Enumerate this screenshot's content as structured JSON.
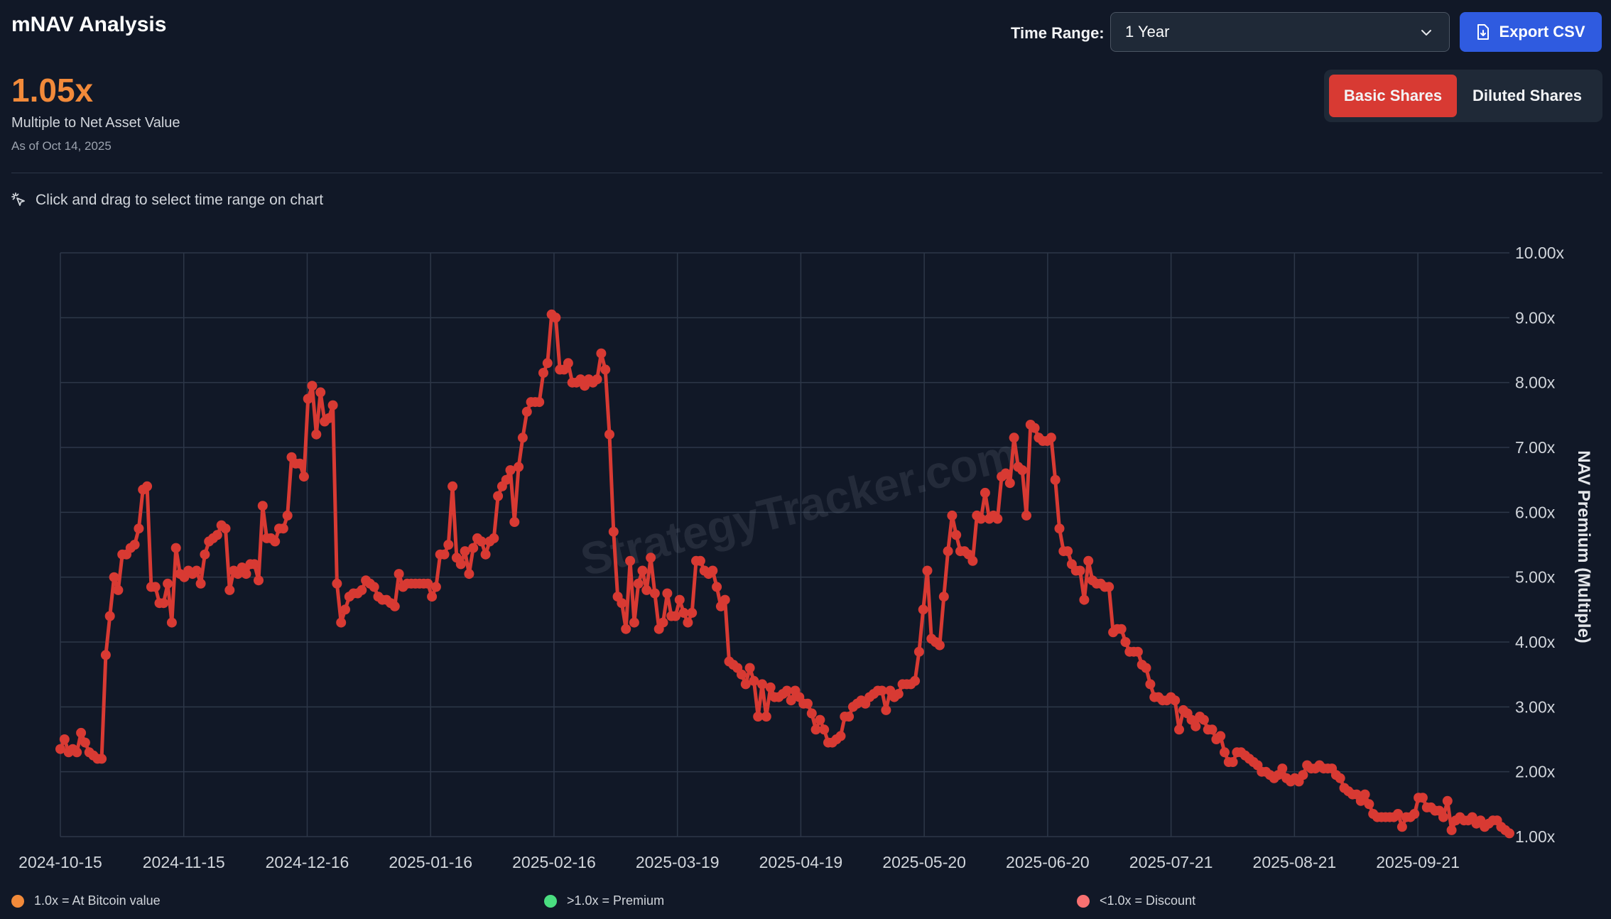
{
  "header": {
    "title": "mNAV Analysis",
    "time_range_label": "Time Range:",
    "time_range_value": "1 Year",
    "export_label": "Export CSV"
  },
  "summary": {
    "value": "1.05x",
    "label": "Multiple to Net Asset Value",
    "as_of": "As of Oct 14, 2025"
  },
  "toggle": {
    "basic": "Basic Shares",
    "diluted": "Diluted Shares",
    "active": "basic"
  },
  "hint": "Click and drag to select time range on chart",
  "watermark": "StrategyTracker.com",
  "legend": [
    {
      "label": "1.0x = At Bitcoin value",
      "color": "#f28a3a"
    },
    {
      "label": ">1.0x = Premium",
      "color": "#4ade80"
    },
    {
      "label": "<1.0x = Discount",
      "color": "#f87171"
    }
  ],
  "colors": {
    "series": "#d83a33",
    "accent": "#f28a3a",
    "grid": "#2d3748"
  },
  "chart_data": {
    "type": "line",
    "ylabel": "NAV Premium (Multiple)",
    "ylim": [
      1,
      10
    ],
    "yticks": [
      "10.00x",
      "9.00x",
      "8.00x",
      "7.00x",
      "6.00x",
      "5.00x",
      "4.00x",
      "3.00x",
      "2.00x",
      "1.00x"
    ],
    "xticks": [
      "2024-10-15",
      "2024-11-15",
      "2024-12-16",
      "2025-01-16",
      "2025-02-16",
      "2025-03-19",
      "2025-04-19",
      "2025-05-20",
      "2025-06-20",
      "2025-07-21",
      "2025-08-21",
      "2025-09-21"
    ],
    "x_start": "2024-10-15",
    "x_end": "2025-10-14",
    "grid": true,
    "legend_position": "bottom",
    "series": [
      {
        "values": [
          2.35,
          2.5,
          2.3,
          2.35,
          2.3,
          2.6,
          2.45,
          2.3,
          2.25,
          2.2,
          2.2,
          3.8,
          4.4,
          5,
          4.8,
          5.35,
          5.35,
          5.45,
          5.5,
          5.75,
          6.35,
          6.4,
          4.85,
          4.85,
          4.6,
          4.6,
          4.9,
          4.3,
          5.45,
          5.05,
          5,
          5.1,
          5.05,
          5.1,
          4.9,
          5.35,
          5.55,
          5.6,
          5.65,
          5.8,
          5.75,
          4.8,
          5.1,
          5.05,
          5.15,
          5.05,
          5.2,
          5.2,
          4.95,
          6.1,
          5.6,
          5.6,
          5.55,
          5.75,
          5.75,
          5.95,
          6.85,
          6.75,
          6.75,
          6.55,
          7.75,
          7.95,
          7.2,
          7.85,
          7.4,
          7.45,
          7.65,
          4.9,
          4.3,
          4.5,
          4.7,
          4.75,
          4.75,
          4.8,
          4.95,
          4.9,
          4.85,
          4.7,
          4.65,
          4.65,
          4.6,
          4.55,
          5.05,
          4.85,
          4.9,
          4.9,
          4.9,
          4.9,
          4.9,
          4.9,
          4.7,
          4.85,
          5.35,
          5.35,
          5.5,
          6.4,
          5.3,
          5.2,
          5.4,
          5.05,
          5.45,
          5.6,
          5.55,
          5.35,
          5.55,
          5.6,
          6.25,
          6.4,
          6.5,
          6.65,
          5.85,
          6.7,
          7.15,
          7.55,
          7.7,
          7.7,
          7.7,
          8.15,
          8.3,
          9.05,
          9.0,
          8.2,
          8.2,
          8.3,
          8.0,
          8.0,
          8.05,
          7.95,
          8.05,
          8.0,
          8.05,
          8.45,
          8.2,
          7.2,
          5.7,
          4.7,
          4.6,
          4.2,
          5.25,
          4.3,
          4.9,
          5.1,
          4.8,
          5.3,
          4.75,
          4.2,
          4.3,
          4.75,
          4.4,
          4.4,
          4.65,
          4.45,
          4.3,
          4.45,
          5.25,
          5.25,
          5.1,
          5.05,
          5.1,
          4.85,
          4.55,
          4.65,
          3.7,
          3.65,
          3.6,
          3.5,
          3.35,
          3.6,
          3.4,
          2.85,
          3.35,
          2.85,
          3.3,
          3.15,
          3.15,
          3.2,
          3.25,
          3.1,
          3.25,
          3.15,
          3.05,
          3.05,
          2.9,
          2.65,
          2.8,
          2.65,
          2.45,
          2.45,
          2.5,
          2.55,
          2.85,
          2.85,
          3.0,
          3.05,
          3.1,
          3.05,
          3.15,
          3.2,
          3.25,
          3.25,
          2.95,
          3.25,
          3.15,
          3.2,
          3.35,
          3.35,
          3.35,
          3.4,
          3.85,
          4.5,
          5.1,
          4.05,
          4.0,
          3.95,
          4.7,
          5.4,
          5.95,
          5.65,
          5.4,
          5.4,
          5.35,
          5.25,
          5.95,
          5.9,
          6.3,
          5.9,
          5.95,
          5.9,
          6.55,
          6.6,
          6.45,
          7.15,
          6.7,
          6.65,
          5.95,
          7.35,
          7.3,
          7.15,
          7.1,
          7.1,
          7.15,
          6.5,
          5.75,
          5.4,
          5.4,
          5.2,
          5.1,
          5.1,
          4.65,
          5.25,
          4.95,
          4.9,
          4.9,
          4.85,
          4.85,
          4.15,
          4.2,
          4.2,
          4.0,
          3.85,
          3.85,
          3.85,
          3.65,
          3.6,
          3.35,
          3.15,
          3.15,
          3.1,
          3.1,
          3.15,
          3.1,
          2.65,
          2.95,
          2.9,
          2.8,
          2.7,
          2.85,
          2.8,
          2.65,
          2.65,
          2.5,
          2.55,
          2.3,
          2.15,
          2.15,
          2.3,
          2.3,
          2.25,
          2.2,
          2.15,
          2.1,
          2.0,
          2.0,
          1.95,
          1.9,
          1.95,
          2.05,
          1.9,
          1.85,
          1.9,
          1.85,
          1.95,
          2.1,
          2.05,
          2.05,
          2.1,
          2.05,
          2.05,
          2.05,
          1.95,
          1.9,
          1.75,
          1.7,
          1.65,
          1.65,
          1.55,
          1.65,
          1.5,
          1.35,
          1.3,
          1.3,
          1.3,
          1.3,
          1.3,
          1.35,
          1.15,
          1.3,
          1.3,
          1.35,
          1.6,
          1.6,
          1.45,
          1.45,
          1.4,
          1.4,
          1.3,
          1.55,
          1.1,
          1.25,
          1.3,
          1.25,
          1.25,
          1.3,
          1.2,
          1.25,
          1.15,
          1.2,
          1.25,
          1.25,
          1.15,
          1.1,
          1.05
        ]
      }
    ]
  }
}
